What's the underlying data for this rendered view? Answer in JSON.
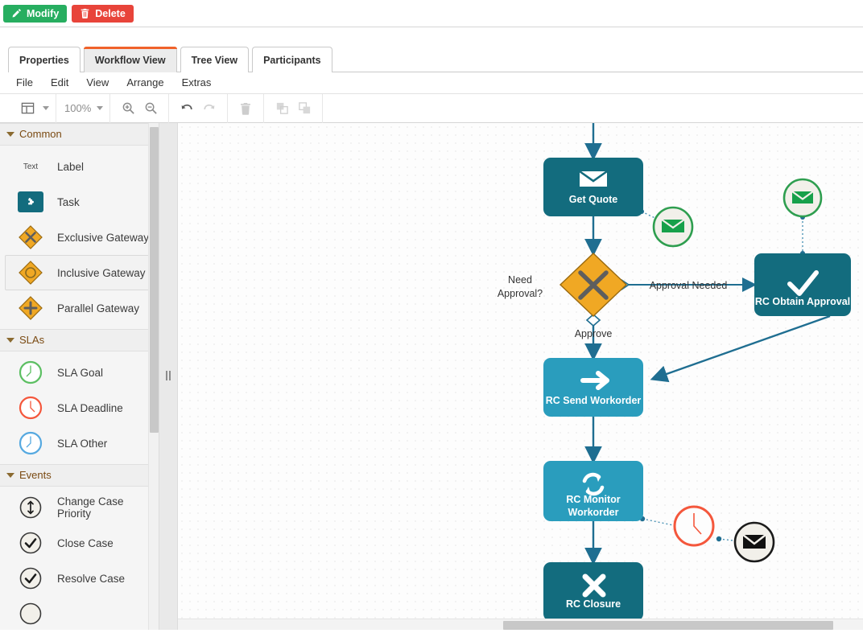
{
  "action_bar": {
    "modify_label": "Modify",
    "delete_label": "Delete"
  },
  "tabs": [
    {
      "label": "Properties",
      "active": false
    },
    {
      "label": "Workflow View",
      "active": true
    },
    {
      "label": "Tree View",
      "active": false
    },
    {
      "label": "Participants",
      "active": false
    }
  ],
  "menu": [
    "File",
    "Edit",
    "View",
    "Arrange",
    "Extras"
  ],
  "toolbar": {
    "zoom_level": "100%",
    "buttons": [
      "view-layout-button",
      "zoom-dropdown",
      "zoom-in-button",
      "zoom-out-button",
      "undo-button",
      "redo-button",
      "delete-button",
      "to-front-button",
      "to-back-button"
    ]
  },
  "palette": {
    "sections": [
      {
        "title": "Common",
        "items": [
          {
            "label": "Label",
            "icon": "text-icon",
            "selected": false
          },
          {
            "label": "Task",
            "icon": "task-icon",
            "selected": false
          },
          {
            "label": "Exclusive Gateway",
            "icon": "exclusive-gateway-icon",
            "selected": false
          },
          {
            "label": "Inclusive Gateway",
            "icon": "inclusive-gateway-icon",
            "selected": true
          },
          {
            "label": "Parallel Gateway",
            "icon": "parallel-gateway-icon",
            "selected": false
          }
        ]
      },
      {
        "title": "SLAs",
        "items": [
          {
            "label": "SLA Goal",
            "icon": "clock-green-icon",
            "selected": false
          },
          {
            "label": "SLA Deadline",
            "icon": "clock-red-icon",
            "selected": false
          },
          {
            "label": "SLA Other",
            "icon": "clock-blue-icon",
            "selected": false
          }
        ]
      },
      {
        "title": "Events",
        "items": [
          {
            "label": "Change Case Priority",
            "icon": "priority-arrow-icon",
            "selected": false
          },
          {
            "label": "Close Case",
            "icon": "check-circle-icon",
            "selected": false
          },
          {
            "label": "Resolve Case",
            "icon": "check-circle-icon",
            "selected": false
          }
        ]
      }
    ],
    "text_glyph": "Text"
  },
  "diagram": {
    "nodes": [
      {
        "id": "get-quote",
        "label": "Get Quote",
        "icon": "envelope-icon",
        "color": "#136c7e"
      },
      {
        "id": "need-approval-gateway",
        "label": "Need Approval?",
        "icon": "x-icon",
        "color": "#f0a824"
      },
      {
        "id": "rc-obtain-approval",
        "label": "RC Obtain Approval",
        "icon": "check-icon",
        "color": "#136c7e"
      },
      {
        "id": "rc-send-workorder",
        "label": "RC Send Workorder",
        "icon": "arrow-right-icon",
        "color": "#2a9dbd"
      },
      {
        "id": "rc-monitor-workorder",
        "label": "RC Monitor Workorder",
        "icon": "refresh-icon",
        "color": "#2a9dbd"
      },
      {
        "id": "rc-closure",
        "label": "RC Closure",
        "icon": "x-icon",
        "color": "#136c7e"
      }
    ],
    "node_labels": {
      "get_quote": "Get Quote",
      "need_approval_line1": "Need",
      "need_approval_line2": "Approval?",
      "rc_obtain_approval": "RC Obtain Approval",
      "rc_send_workorder": "RC Send Workorder",
      "rc_monitor_line1": "RC Monitor",
      "rc_monitor_line2": "Workorder",
      "rc_closure": "RC Closure"
    },
    "edge_labels": {
      "approval_needed": "Approval Needed",
      "approve": "Approve"
    },
    "events": [
      {
        "id": "get-quote-message-event",
        "icon": "envelope-icon",
        "ring": "#2e9e4f"
      },
      {
        "id": "obtain-approval-message-event",
        "icon": "envelope-icon",
        "ring": "#2e9e4f"
      },
      {
        "id": "monitor-timer-event",
        "icon": "clock-icon",
        "ring": "#f4573c"
      },
      {
        "id": "monitor-message-event",
        "icon": "envelope-icon",
        "ring": "#1b1b1b"
      }
    ]
  },
  "colors": {
    "accent_orange": "#f0622a",
    "task_dark": "#136c7e",
    "task_light": "#2a9dbd",
    "gateway_orange": "#f0a824",
    "edge": "#1f6e91",
    "green": "#27ae60",
    "red": "#e8443a"
  }
}
